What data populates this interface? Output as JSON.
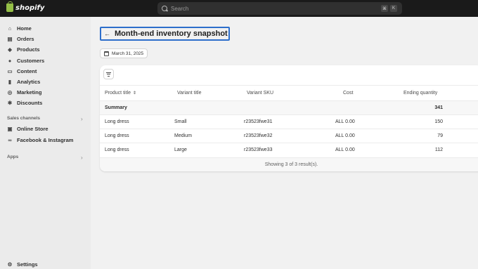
{
  "topbar": {
    "logo_text": "shopify",
    "search_placeholder": "Search",
    "shortcut_keys": [
      "⌘",
      "K"
    ]
  },
  "sidebar": {
    "items": [
      {
        "label": "Home",
        "icon": "home-icon"
      },
      {
        "label": "Orders",
        "icon": "orders-icon"
      },
      {
        "label": "Products",
        "icon": "tag-icon"
      },
      {
        "label": "Customers",
        "icon": "person-icon"
      },
      {
        "label": "Content",
        "icon": "content-icon"
      },
      {
        "label": "Analytics",
        "icon": "chart-icon"
      },
      {
        "label": "Marketing",
        "icon": "target-icon"
      },
      {
        "label": "Discounts",
        "icon": "discount-icon"
      }
    ],
    "sales_channels_label": "Sales channels",
    "channels": [
      {
        "label": "Online Store",
        "icon": "store-icon"
      },
      {
        "label": "Facebook & Instagram",
        "icon": "meta-icon"
      }
    ],
    "apps_label": "Apps",
    "settings_label": "Settings"
  },
  "page": {
    "title": "Month-end inventory snapshot",
    "date": "March 31, 2025"
  },
  "table": {
    "columns": [
      "Product title",
      "Variant title",
      "Variant SKU",
      "Cost",
      "Ending quantity"
    ],
    "summary": {
      "label": "Summary",
      "ending_quantity": "341"
    },
    "rows": [
      {
        "product": "Long dress",
        "variant": "Small",
        "sku": "r23523fwe31",
        "cost": "ALL 0.00",
        "qty": "150"
      },
      {
        "product": "Long dress",
        "variant": "Medium",
        "sku": "r23523fwe32",
        "cost": "ALL 0.00",
        "qty": "79"
      },
      {
        "product": "Long dress",
        "variant": "Large",
        "sku": "r23523fwe33",
        "cost": "ALL 0.00",
        "qty": "112"
      }
    ],
    "footer": "Showing 3 of 3 result(s)."
  },
  "colors": {
    "topbar": "#1a1a1a",
    "sidebar": "#ebebeb",
    "background": "#f1f1f1",
    "focus_outline": "#2c6ecb",
    "logo_green": "#95bf47"
  }
}
